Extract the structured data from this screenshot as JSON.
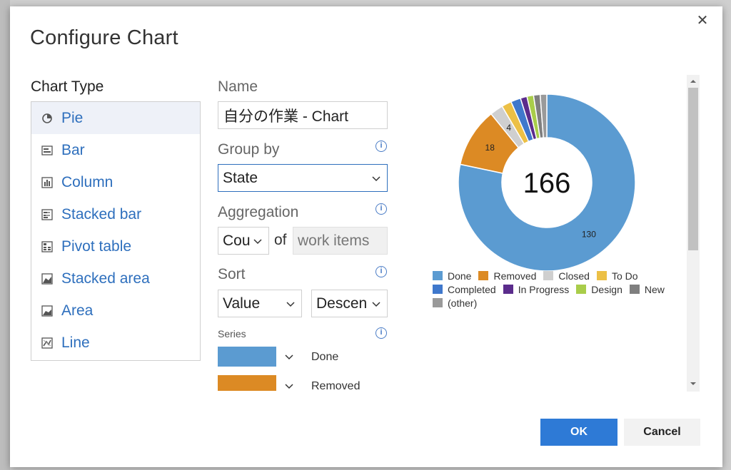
{
  "dialog": {
    "title": "Configure Chart",
    "close_label": "✕"
  },
  "chart_type": {
    "label": "Chart Type",
    "items": [
      {
        "label": "Pie",
        "icon": "pie-icon",
        "selected": true
      },
      {
        "label": "Bar",
        "icon": "bar-icon",
        "selected": false
      },
      {
        "label": "Column",
        "icon": "column-icon",
        "selected": false
      },
      {
        "label": "Stacked bar",
        "icon": "stacked-bar-icon",
        "selected": false
      },
      {
        "label": "Pivot table",
        "icon": "pivot-table-icon",
        "selected": false
      },
      {
        "label": "Stacked area",
        "icon": "stacked-area-icon",
        "selected": false
      },
      {
        "label": "Area",
        "icon": "area-icon",
        "selected": false
      },
      {
        "label": "Line",
        "icon": "line-icon",
        "selected": false
      }
    ]
  },
  "form": {
    "name_label": "Name",
    "name_value": "自分の作業 - Chart",
    "group_by_label": "Group by",
    "group_by_value": "State",
    "aggregation_label": "Aggregation",
    "aggregation_value": "Cou",
    "of_label": "of",
    "aggregation_target": "work items",
    "sort_label": "Sort",
    "sort_field": "Value",
    "sort_direction": "Descen",
    "series_label": "Series",
    "series": [
      {
        "name": "Done",
        "color": "#5b9bd1"
      },
      {
        "name": "Removed",
        "color": "#dc8a24"
      }
    ]
  },
  "chart_data": {
    "type": "pie",
    "total_label": "166",
    "categories": [
      "Done",
      "Removed",
      "Closed",
      "To Do",
      "Completed",
      "In Progress",
      "Design",
      "New",
      "(other)"
    ],
    "values": [
      130,
      18,
      4,
      3,
      3,
      2,
      2,
      2,
      2
    ],
    "data_labels": [
      "130",
      "18",
      "4",
      "",
      "",
      "",
      "",
      "",
      ""
    ],
    "colors": [
      "#5b9bd1",
      "#dc8a24",
      "#cfcfcf",
      "#ecc046",
      "#3f78cc",
      "#5b2c8c",
      "#a9cd4a",
      "#7f7f7f",
      "#9a9a9a"
    ],
    "legend_position": "bottom"
  },
  "buttons": {
    "ok": "OK",
    "cancel": "Cancel"
  }
}
